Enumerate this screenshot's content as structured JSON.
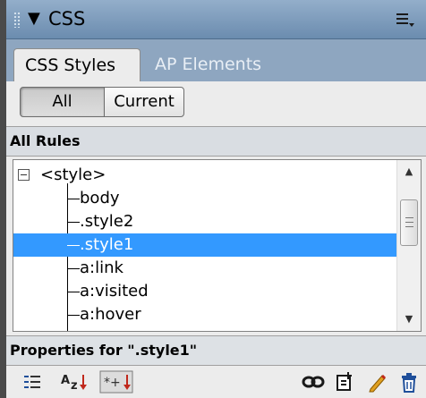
{
  "panel": {
    "title": "CSS",
    "tabs": [
      {
        "label": "CSS Styles",
        "active": true
      },
      {
        "label": "AP Elements",
        "active": false
      }
    ],
    "mode_buttons": {
      "all_label": "All",
      "current_label": "Current",
      "selected": "All"
    }
  },
  "rules": {
    "header": "All Rules",
    "root": "<style>",
    "items": [
      {
        "label": "body"
      },
      {
        "label": ".style2"
      },
      {
        "label": ".style1",
        "selected": true
      },
      {
        "label": "a:link"
      },
      {
        "label": "a:visited"
      },
      {
        "label": "a:hover"
      }
    ]
  },
  "properties": {
    "header": "Properties for \".style1\""
  },
  "colors": {
    "titlebar": "#7d9bbd",
    "selection": "#3399ff",
    "edit_icon": "#e0a020",
    "trash_icon": "#1f4f9a"
  },
  "icons": [
    "category-view-icon",
    "alpha-sort-icon",
    "set-properties-icon",
    "attach-stylesheet-icon",
    "new-rule-icon",
    "edit-rule-icon",
    "delete-rule-icon"
  ]
}
